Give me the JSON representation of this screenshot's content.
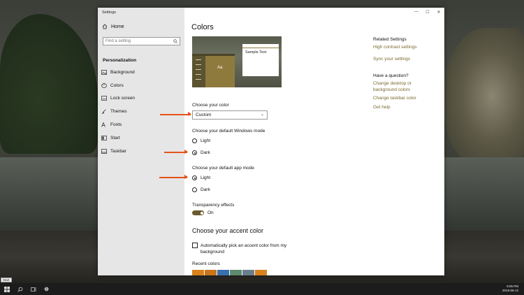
{
  "window": {
    "title": "Settings",
    "controls": {
      "minimize": "—",
      "maximize": "☐",
      "close": "✕"
    }
  },
  "sidebar": {
    "home_label": "Home",
    "search_placeholder": "Find a setting",
    "section_label": "Personalization",
    "items": [
      {
        "label": "Background",
        "icon": "image-icon"
      },
      {
        "label": "Colors",
        "icon": "palette-icon"
      },
      {
        "label": "Lock screen",
        "icon": "lock-screen-icon"
      },
      {
        "label": "Themes",
        "icon": "brush-icon"
      },
      {
        "label": "Fonts",
        "icon": "font-icon"
      },
      {
        "label": "Start",
        "icon": "start-icon"
      },
      {
        "label": "Taskbar",
        "icon": "taskbar-icon"
      }
    ]
  },
  "main": {
    "title": "Colors",
    "preview": {
      "sample_text": "Sample Text",
      "aa_text": "Aa"
    },
    "choose_color": {
      "label": "Choose your color",
      "value": "Custom"
    },
    "windows_mode": {
      "label": "Choose your default Windows mode",
      "options": [
        "Light",
        "Dark"
      ],
      "selected": "Dark"
    },
    "app_mode": {
      "label": "Choose your default app mode",
      "options": [
        "Light",
        "Dark"
      ],
      "selected": "Light"
    },
    "transparency": {
      "label": "Transparency effects",
      "state": "On"
    },
    "accent_heading": "Choose your accent color",
    "auto_accent": {
      "label": "Automatically pick an accent color from my background",
      "checked": false
    },
    "recent_colors": {
      "label": "Recent colors",
      "colors": [
        "#d9821e",
        "#c9751a",
        "#3a6fb0",
        "#5e8a6e",
        "#6a7f8e",
        "#d9821e"
      ]
    }
  },
  "related": {
    "heading": "Related Settings",
    "links": [
      "High contrast settings",
      "Sync your settings"
    ],
    "question_heading": "Have a question?",
    "help_links": [
      "Change desktop or background colors",
      "Change taskbar color",
      "Get help"
    ]
  },
  "taskbar": {
    "start_tooltip": "Start",
    "time": "9:05 PM",
    "date": "2019-06-12"
  },
  "colors": {
    "accent": "#7a6a2e",
    "arrow": "#e5531a"
  }
}
